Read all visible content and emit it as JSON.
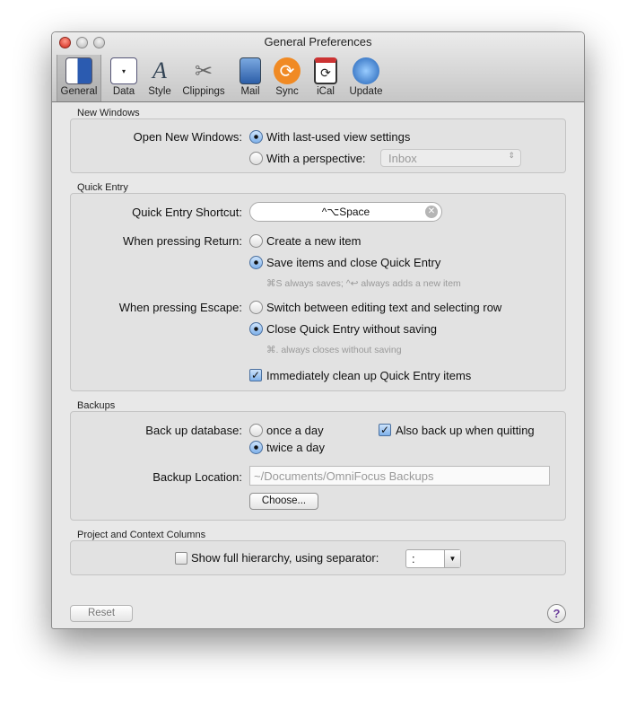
{
  "window": {
    "title": "General Preferences"
  },
  "toolbar": [
    {
      "label": "General",
      "icon": "general-icon"
    },
    {
      "label": "Data",
      "icon": "data-icon"
    },
    {
      "label": "Style",
      "icon": "style-icon"
    },
    {
      "label": "Clippings",
      "icon": "clippings-icon"
    },
    {
      "label": "Mail",
      "icon": "mail-icon"
    },
    {
      "label": "Sync",
      "icon": "sync-icon"
    },
    {
      "label": "iCal",
      "icon": "ical-icon"
    },
    {
      "label": "Update",
      "icon": "update-icon"
    }
  ],
  "new_windows": {
    "section": "New Windows",
    "label": "Open New Windows:",
    "opt1": "With last-used view settings",
    "opt2": "With a perspective:",
    "perspective": "Inbox"
  },
  "quick_entry": {
    "section": "Quick Entry",
    "shortcut_label": "Quick Entry Shortcut:",
    "shortcut": "^⌥Space",
    "return_label": "When pressing Return:",
    "return_opt1": "Create a new item",
    "return_opt2": "Save items and close Quick Entry",
    "return_hint": "⌘S always saves; ^↩ always adds a new item",
    "escape_label": "When pressing Escape:",
    "escape_opt1": "Switch between editing text and selecting row",
    "escape_opt2": "Close Quick Entry without saving",
    "escape_hint": "⌘. always closes without saving",
    "cleanup": "Immediately clean up Quick Entry items"
  },
  "backups": {
    "section": "Backups",
    "label": "Back up database:",
    "opt1": "once a day",
    "opt2": "twice a day",
    "also": "Also back up when quitting",
    "location_label": "Backup Location:",
    "location": "~/Documents/OmniFocus Backups",
    "choose": "Choose..."
  },
  "columns": {
    "section": "Project and Context Columns",
    "hierarchy": "Show full hierarchy, using separator:",
    "separator": ":"
  },
  "footer": {
    "reset": "Reset",
    "help": "?"
  }
}
